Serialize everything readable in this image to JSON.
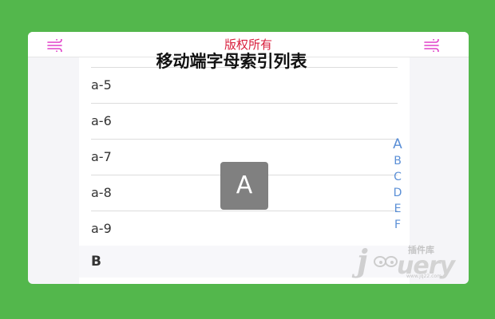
{
  "header": {
    "title": "版权所有",
    "left_icon": "wind-icon",
    "right_icon": "wind-icon",
    "accent_color": "#d81e3c",
    "icon_color": "#e040c8"
  },
  "page_title": "移动端字母索引列表",
  "list": {
    "rows": [
      {
        "label": "a-5"
      },
      {
        "label": "a-6"
      },
      {
        "label": "a-7"
      },
      {
        "label": "a-8"
      },
      {
        "label": "a-9"
      }
    ],
    "group_header": "B"
  },
  "index_bar": {
    "letters": [
      "A",
      "B",
      "C",
      "D",
      "E",
      "F"
    ],
    "color": "#5b8fd6"
  },
  "overlay": {
    "letter": "A"
  },
  "watermark": {
    "brand": "jQuery",
    "brand_j": "j",
    "brand_rest": "uery",
    "cn": "插件库",
    "sub": "www.jq22.com"
  },
  "colors": {
    "background": "#53b74c",
    "card": "#f5f5f8",
    "divider": "#dcdcdc"
  }
}
